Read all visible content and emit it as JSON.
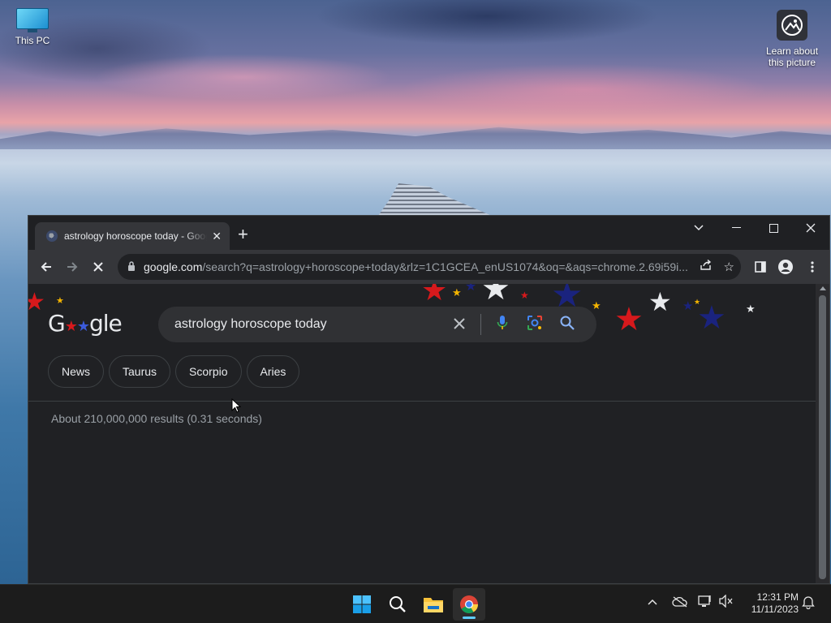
{
  "desktop": {
    "icons": [
      {
        "label": "This PC",
        "icon": "this-pc-icon"
      },
      {
        "label": "Learn about this picture",
        "icon": "learn-picture-icon"
      }
    ]
  },
  "browser": {
    "tab": {
      "title": "astrology horoscope today - Google Search",
      "favicon": "loading-favicon"
    },
    "window_controls": [
      "tab-search-icon",
      "minimize-icon",
      "maximize-icon",
      "close-icon"
    ],
    "address": {
      "host": "google.com",
      "path": "/search?q=astrology+horoscope+today&rlz=1C1GCEA_enUS1074&oq=&aqs=chrome.2.69i59i..."
    },
    "toolbar_icons": [
      "back-icon",
      "forward-icon",
      "stop-icon",
      "share-icon",
      "bookmark-star-icon",
      "side-panel-icon",
      "profile-icon",
      "menu-icon"
    ]
  },
  "search": {
    "logo": "Google",
    "query": "astrology horoscope today",
    "chips": [
      "News",
      "Taurus",
      "Scorpio",
      "Aries"
    ],
    "result_stats": "About 210,000,000 results (0.31 seconds)"
  },
  "taskbar": {
    "apps": [
      "start-icon",
      "search-icon",
      "file-explorer-icon",
      "chrome-icon"
    ],
    "time": "12:31 PM",
    "date": "11/11/2023"
  },
  "colors": {
    "page_bg": "#202124",
    "toolbar_bg": "#35363a",
    "star_red": "#d7191c",
    "star_navy": "#1a237e",
    "star_white": "#e8eaed",
    "star_gold": "#f4b400"
  }
}
